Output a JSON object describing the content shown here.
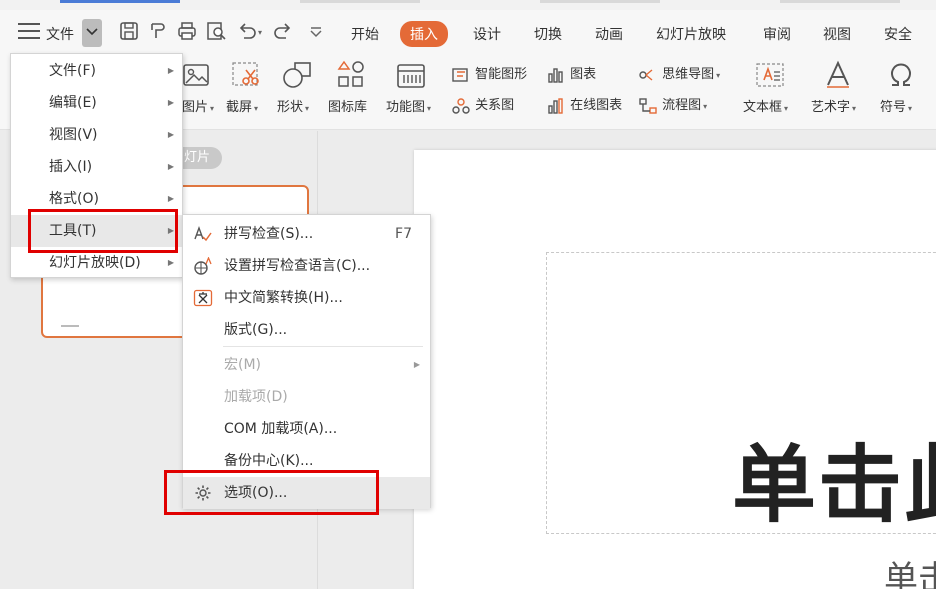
{
  "menubar": {
    "file_label": "文件",
    "tabs": [
      "开始",
      "插入",
      "设计",
      "切换",
      "动画",
      "幻灯片放映",
      "审阅",
      "视图",
      "安全"
    ],
    "active_tab": "插入"
  },
  "ribbon": {
    "items": {
      "picture": "图片",
      "screenshot": "截屏",
      "shape": "形状",
      "iconlib": "图标库",
      "funcchart": "功能图",
      "smartart": "智能图形",
      "chart": "图表",
      "relation": "关系图",
      "onlinechart": "在线图表",
      "mindmap": "思维导图",
      "flowchart": "流程图",
      "textbox": "文本框",
      "wordart": "艺术字",
      "symbol": "符号"
    }
  },
  "leftpane": {
    "slide_label": "灯片"
  },
  "slide": {
    "title": "单击此",
    "subtitle": "单击"
  },
  "main_menu": {
    "items": [
      {
        "label": "文件(F)",
        "has_sub": true
      },
      {
        "label": "编辑(E)",
        "has_sub": true
      },
      {
        "label": "视图(V)",
        "has_sub": true
      },
      {
        "label": "插入(I)",
        "has_sub": true
      },
      {
        "label": "格式(O)",
        "has_sub": true
      },
      {
        "label": "工具(T)",
        "has_sub": true,
        "highlighted": true
      },
      {
        "label": "幻灯片放映(D)",
        "has_sub": true
      }
    ]
  },
  "tools_menu": {
    "items": [
      {
        "label": "拼写检查(S)...",
        "shortcut": "F7",
        "icon": "spellcheck-icon"
      },
      {
        "label": "设置拼写检查语言(C)...",
        "icon": "language-globe-icon"
      },
      {
        "label": "中文简繁转换(H)...",
        "icon": "chinese-convert-icon"
      },
      {
        "label": "版式(G)..."
      },
      {
        "label": "宏(M)",
        "disabled": true,
        "has_sub": true
      },
      {
        "label": "加载项(D)",
        "disabled": true
      },
      {
        "label": "COM 加载项(A)..."
      },
      {
        "label": "备份中心(K)..."
      },
      {
        "label": "选项(O)...",
        "icon": "gear-icon",
        "highlighted": true
      }
    ]
  },
  "colors": {
    "accent": "#e46a37",
    "highlight_box": "#e00000"
  }
}
